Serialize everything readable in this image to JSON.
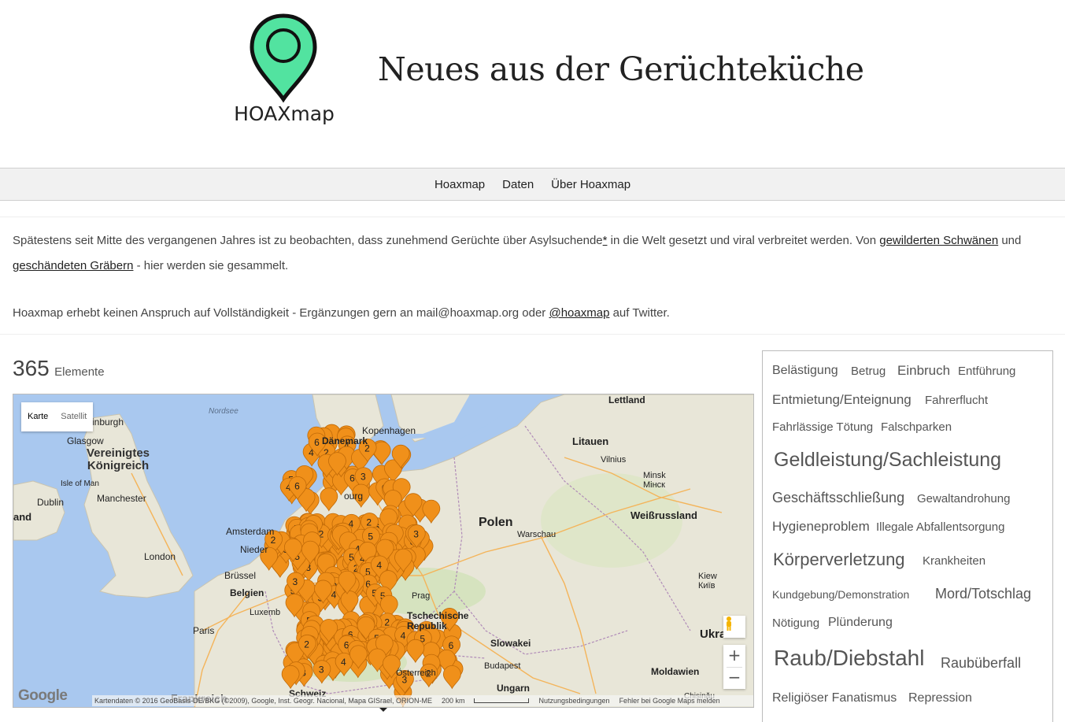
{
  "header": {
    "logo_text": "HOAXmap",
    "site_title": "Neues aus der Gerüchteküche",
    "logo_color": "#52e3a0"
  },
  "nav": {
    "items": [
      "Hoaxmap",
      "Daten",
      "Über Hoaxmap"
    ]
  },
  "intro": {
    "part1": "Spätestens seit Mitte des vergangenen Jahres ist zu beobachten, dass zunehmend Gerüchte über Asylsuchende",
    "asterisk": "*",
    "part2": " in die Welt gesetzt und viral verbreitet werden. Von ",
    "link1": "gewilderten Schwänen",
    "part3": " und",
    "link2": "geschändeten Gräbern",
    "part4": " - hier werden sie gesammelt."
  },
  "note": {
    "part1": "Hoaxmap erhebt keinen Anspruch auf Vollständigkeit - Ergänzungen gern an mail@hoaxmap.org oder ",
    "link": "@hoaxmap",
    "part2": " auf Twitter."
  },
  "count": {
    "number": "365",
    "label": "Elemente"
  },
  "map": {
    "type_map": "Karte",
    "type_satellite": "Satellit",
    "zoom_in": "+",
    "zoom_out": "−",
    "google": "Google",
    "attribution": "Kartendaten © 2016 GeoBasis-DE/BKG (©2009), Google, Inst. Geogr. Nacional, Mapa GISrael, ORION-ME",
    "scale": "200 km",
    "terms": "Nutzungsbedingungen",
    "report": "Fehler bei Google Maps melden",
    "marker_color": "#f0901a",
    "labels": {
      "nordsee": "Nordsee",
      "edinburgh": "inburgh",
      "glasgow": "Glasgow",
      "uk": "Vereinigtes Königreich",
      "isle_of_man": "Isle of Man",
      "dublin": "Dublin",
      "ireland": "and",
      "manchester": "Manchester",
      "london": "London",
      "amsterdam": "Amsterdam",
      "niederlande": "Nieder",
      "brussel": "Brüssel",
      "belgien": "Belgien",
      "luxemburg": "Luxemb",
      "paris": "Paris",
      "frankreich": "Frankreich",
      "schweiz": "Schweiz",
      "daenemark": "Dänemark",
      "kopenhagen": "Kopenhagen",
      "hamburg": "ourg",
      "lettland": "Lettland",
      "litauen": "Litauen",
      "vilnius": "Vilnius",
      "minsk": "Minsk\nМінск",
      "weissrussland": "Weißrussland",
      "polen": "Polen",
      "warschau": "Warschau",
      "prag": "Prag",
      "tschechische": "Tschechische\nRepublik",
      "slowakei": "Slowakei",
      "budapest": "Budapest",
      "ungarn": "Ungarn",
      "oesterreich": "Österreich",
      "moldawien": "Moldawien",
      "kiew": "Kiew\nКиїв",
      "ukraine": "Ukraine",
      "chisinau": "Chișinău"
    }
  },
  "tags": [
    "Belästigung",
    "Betrug",
    "Einbruch",
    "Entführung",
    "Entmietung/Enteignung",
    "Fahrerflucht",
    "Fahrlässige Tötung",
    "Falschparken",
    "Geldleistung/Sachleistung",
    "Geschäftsschließung",
    "Gewaltandrohung",
    "Hygieneproblem",
    "Illegale Abfallentsorgung",
    "Körperverletzung",
    "Krankheiten",
    "Kundgebung/Demonstration",
    "Mord/Totschlag",
    "Nötigung",
    "Plünderung",
    "Raub/Diebstahl",
    "Raubüberfall",
    "Religiöser Fanatismus",
    "Repression"
  ]
}
